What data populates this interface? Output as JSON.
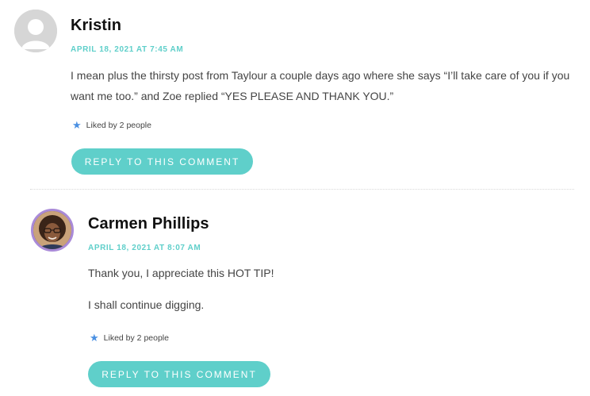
{
  "comments": [
    {
      "author": "Kristin",
      "date": "APRIL 18, 2021 AT 7:45 AM",
      "paragraphs": [
        "I mean plus the thirsty post from Taylour a couple days ago where she says “I’ll take care of you if you want me too.” and Zoe replied “YES PLEASE AND THANK YOU.”"
      ],
      "likes": "Liked by 2 people",
      "reply_label": "REPLY TO THIS COMMENT",
      "avatar_icon": "default-user-avatar-icon"
    },
    {
      "author": "Carmen Phillips",
      "date": "APRIL 18, 2021 AT 8:07 AM",
      "paragraphs": [
        "Thank you, I appreciate this HOT TIP!",
        "I shall continue digging."
      ],
      "likes": "Liked by 2 people",
      "reply_label": "REPLY TO THIS COMMENT",
      "avatar_icon": "user-photo-avatar"
    }
  ],
  "colors": {
    "accent": "#5fcfca",
    "avatar_ring": "#a98ad8",
    "star": "#4a90e2"
  }
}
